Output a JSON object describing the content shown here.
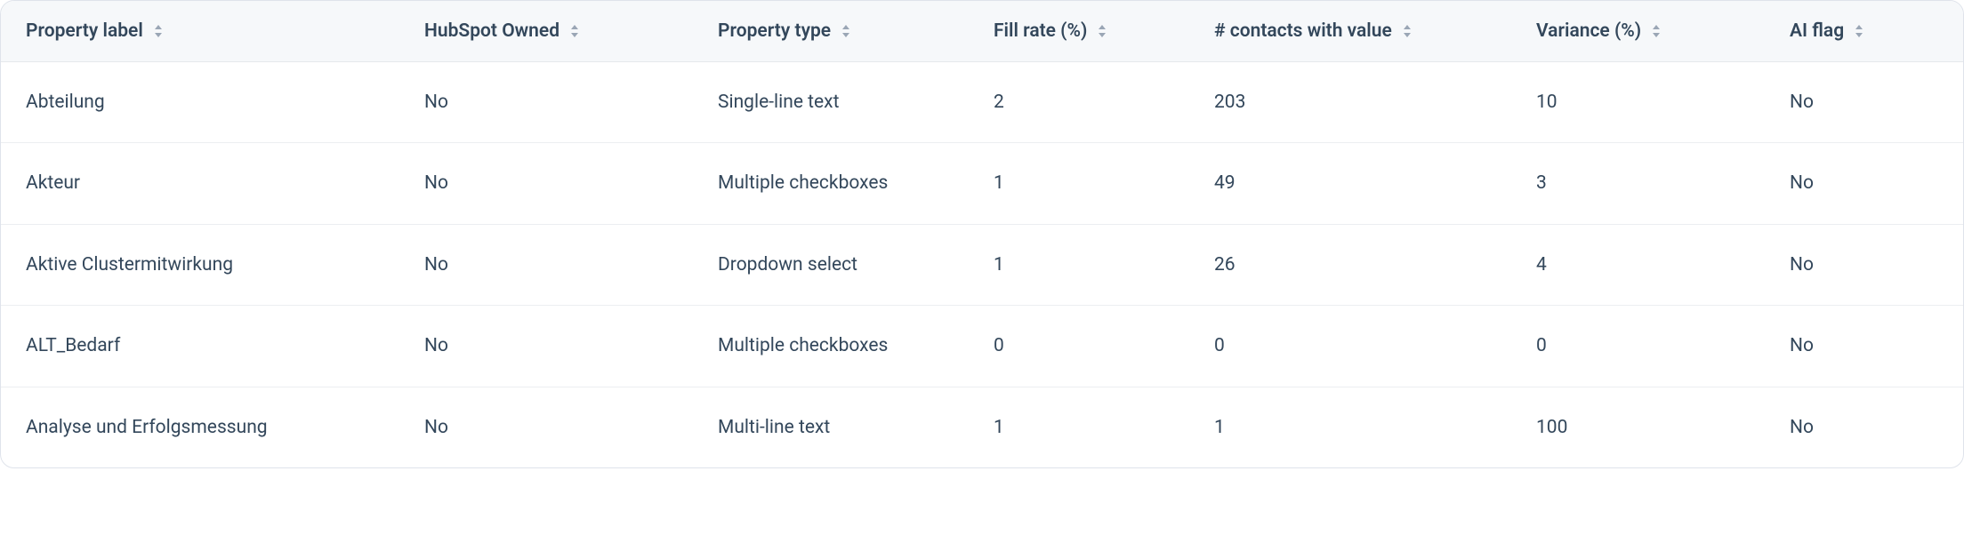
{
  "table": {
    "columns": [
      {
        "label": "Property label"
      },
      {
        "label": "HubSpot Owned"
      },
      {
        "label": "Property type"
      },
      {
        "label": "Fill rate (%)"
      },
      {
        "label": "# contacts with value"
      },
      {
        "label": "Variance (%)"
      },
      {
        "label": "AI flag"
      }
    ],
    "rows": [
      {
        "property_label": "Abteilung",
        "hubspot_owned": "No",
        "property_type": "Single-line text",
        "fill_rate": "2",
        "contacts_with_value": "203",
        "variance": "10",
        "ai_flag": "No"
      },
      {
        "property_label": "Akteur",
        "hubspot_owned": "No",
        "property_type": "Multiple checkboxes",
        "fill_rate": "1",
        "contacts_with_value": "49",
        "variance": "3",
        "ai_flag": "No"
      },
      {
        "property_label": "Aktive Clustermitwirkung",
        "hubspot_owned": "No",
        "property_type": "Dropdown select",
        "fill_rate": "1",
        "contacts_with_value": "26",
        "variance": "4",
        "ai_flag": "No"
      },
      {
        "property_label": "ALT_Bedarf",
        "hubspot_owned": "No",
        "property_type": "Multiple checkboxes",
        "fill_rate": "0",
        "contacts_with_value": "0",
        "variance": "0",
        "ai_flag": "No"
      },
      {
        "property_label": "Analyse und Erfolgsmessung",
        "hubspot_owned": "No",
        "property_type": "Multi-line text",
        "fill_rate": "1",
        "contacts_with_value": "1",
        "variance": "100",
        "ai_flag": "No"
      }
    ]
  }
}
